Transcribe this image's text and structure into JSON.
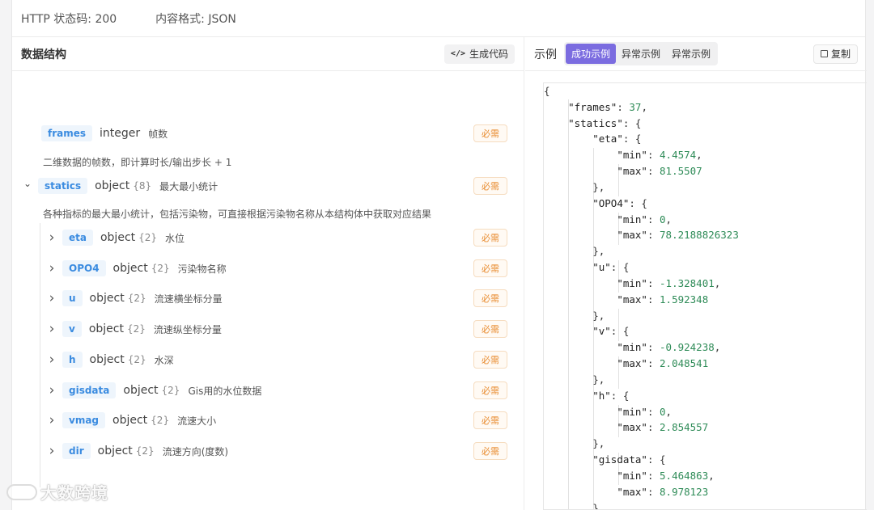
{
  "topbar": {
    "status": "HTTP 状态码: 200",
    "format": "内容格式: JSON"
  },
  "left_panel": {
    "title": "数据结构",
    "generate_button": "生成代码",
    "generate_icon": "code-icon"
  },
  "fields": [
    {
      "name": "frames",
      "type": "integer",
      "count": "",
      "label": "帧数",
      "required": "必需",
      "description": "二维数据的帧数，即计算时长/输出步长 + 1"
    },
    {
      "name": "statics",
      "type": "object",
      "count": "{8}",
      "label": "最大最小统计",
      "required": "必需",
      "description": "各种指标的最大最小统计，包括污染物，可直接根据污染物名称从本结构体中获取对应结果"
    },
    {
      "name": "eta",
      "type": "object",
      "count": "{2}",
      "label": "水位",
      "required": "必需"
    },
    {
      "name": "OPO4",
      "type": "object",
      "count": "{2}",
      "label": "污染物名称",
      "required": "必需"
    },
    {
      "name": "u",
      "type": "object",
      "count": "{2}",
      "label": "流速横坐标分量",
      "required": "必需"
    },
    {
      "name": "v",
      "type": "object",
      "count": "{2}",
      "label": "流速纵坐标分量",
      "required": "必需"
    },
    {
      "name": "h",
      "type": "object",
      "count": "{2}",
      "label": "水深",
      "required": "必需"
    },
    {
      "name": "gisdata",
      "type": "object",
      "count": "{2}",
      "label": "Gis用的水位数据",
      "required": "必需"
    },
    {
      "name": "vmag",
      "type": "object",
      "count": "{2}",
      "label": "流速大小",
      "required": "必需"
    },
    {
      "name": "dir",
      "type": "object",
      "count": "{2}",
      "label": "流速方向(度数)",
      "required": "必需"
    }
  ],
  "right_panel": {
    "title": "示例",
    "tabs": [
      "成功示例",
      "异常示例",
      "异常示例"
    ],
    "active_tab": 0,
    "copy_button": "复制",
    "copy_icon": "copy-icon"
  },
  "code_lines": [
    "{",
    "    \"frames\": 37,",
    "    \"statics\": {",
    "        \"eta\": {",
    "            \"min\": 4.4574,",
    "            \"max\": 81.5507",
    "        },",
    "        \"OPO4\": {",
    "            \"min\": 0,",
    "            \"max\": 78.2188826323",
    "        },",
    "        \"u\": {",
    "            \"min\": -1.328401,",
    "            \"max\": 1.592348",
    "        },",
    "        \"v\": {",
    "            \"min\": -0.924238,",
    "            \"max\": 2.048541",
    "        },",
    "        \"h\": {",
    "            \"min\": 0,",
    "            \"max\": 2.854557",
    "        },",
    "        \"gisdata\": {",
    "            \"min\": 5.464863,",
    "            \"max\": 8.978123",
    "        }"
  ],
  "watermark": "大数跨境",
  "colors": {
    "accent": "#7b6ce0",
    "tag_text": "#3a8be0",
    "required_text": "#e88a2d",
    "json_number": "#2e8b57"
  }
}
